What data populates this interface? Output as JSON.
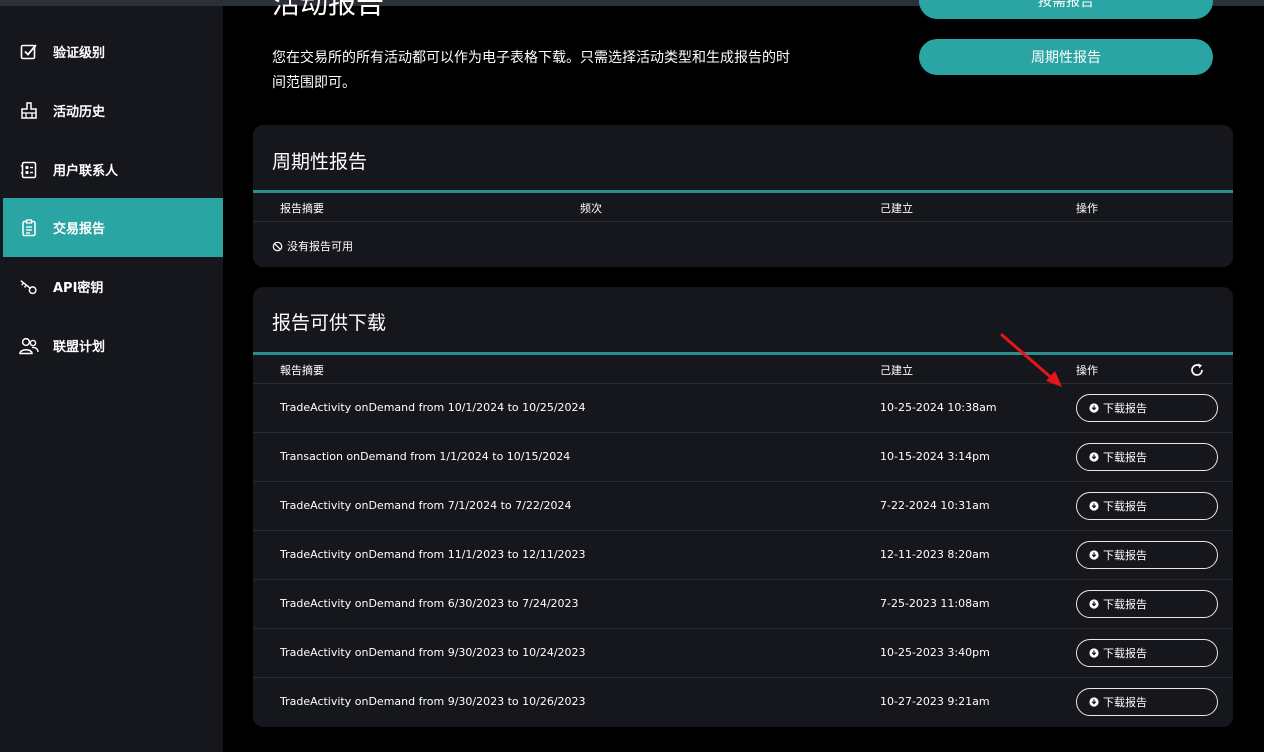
{
  "page": {
    "title": "活动报告",
    "description": "您在交易所的所有活动都可以作为电子表格下载。只需选择活动类型和生成报告的时间范围即可。",
    "top_button_label": "按需报告",
    "periodic_button_label": "周期性报告"
  },
  "sidebar": {
    "items": [
      {
        "label": "验证级别",
        "icon": "checkbox-icon"
      },
      {
        "label": "活动历史",
        "icon": "history-icon"
      },
      {
        "label": "用户联系人",
        "icon": "contacts-icon"
      },
      {
        "label": "交易报告",
        "icon": "report-icon",
        "active": true
      },
      {
        "label": "API密钥",
        "icon": "key-icon"
      },
      {
        "label": "联盟计划",
        "icon": "users-icon"
      }
    ]
  },
  "periodic_reports": {
    "title": "周期性报告",
    "columns": [
      "报告摘要",
      "频次",
      "己建立",
      "操作"
    ],
    "empty_text": "没有报告可用"
  },
  "downloads": {
    "title": "报告可供下载",
    "columns": [
      "報告摘要",
      "己建立",
      "操作"
    ],
    "button_label": "下载报告",
    "rows": [
      {
        "summary": "TradeActivity onDemand from 10/1/2024 to 10/25/2024",
        "created": "10-25-2024 10:38am"
      },
      {
        "summary": "Transaction onDemand from 1/1/2024 to 10/15/2024",
        "created": "10-15-2024 3:14pm"
      },
      {
        "summary": "TradeActivity onDemand from 7/1/2024 to 7/22/2024",
        "created": "7-22-2024 10:31am"
      },
      {
        "summary": "TradeActivity onDemand from 11/1/2023 to 12/11/2023",
        "created": "12-11-2023 8:20am"
      },
      {
        "summary": "TradeActivity onDemand from 6/30/2023 to 7/24/2023",
        "created": "7-25-2023 11:08am"
      },
      {
        "summary": "TradeActivity onDemand from 9/30/2023 to 10/24/2023",
        "created": "10-25-2023 3:40pm"
      },
      {
        "summary": "TradeActivity onDemand from 9/30/2023 to 10/26/2023",
        "created": "10-27-2023 9:21am"
      }
    ]
  },
  "colors": {
    "accent": "#2aa5a3",
    "sidebar_bg": "#16171c",
    "card_bg": "#16171c",
    "page_bg": "#000000",
    "annotation_arrow": "#e8141b"
  }
}
